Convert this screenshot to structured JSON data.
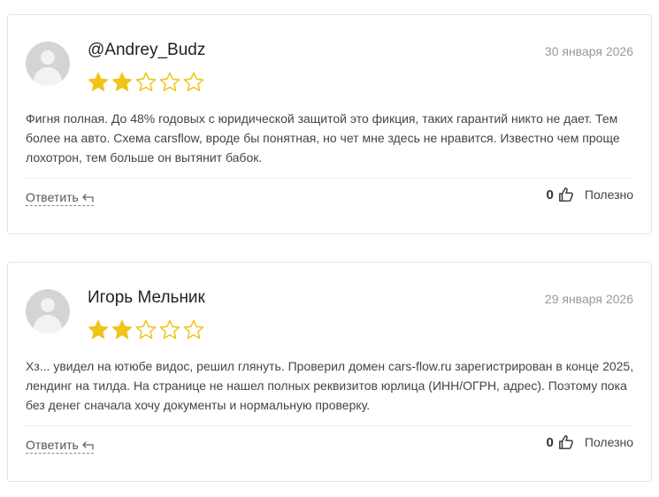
{
  "colors": {
    "star_filled": "#f0c419",
    "star_empty": "#f0c419",
    "border": "#e6e6e6"
  },
  "reviews": [
    {
      "author": "@Andrey_Budz",
      "date": "30 января 2026",
      "rating": 2,
      "max_rating": 5,
      "text": "Фигня полная. До 48% годовых с юридической защитой это фикция, таких гарантий никто не дает. Тем более на авто. Схема carsflow, вроде бы понятная, но чет мне здесь не нравится. Известно чем проще лохотрон, тем больше он вытянит бабок.",
      "reply_label": "Ответить",
      "helpful_count": "0",
      "helpful_label": "Полезно"
    },
    {
      "author": "Игорь Мельник",
      "date": "29 января 2026",
      "rating": 2,
      "max_rating": 5,
      "text": "Хз... увидел на ютюбе видос, решил глянуть. Проверил домен cars-flow.ru зарегистрирован в конце 2025, лендинг на тилда. На странице не нашел полных реквизитов юрлица (ИНН/ОГРН, адрес). Поэтому пока без денег сначала хочу документы и нормальную проверку.",
      "reply_label": "Ответить",
      "helpful_count": "0",
      "helpful_label": "Полезно"
    }
  ]
}
